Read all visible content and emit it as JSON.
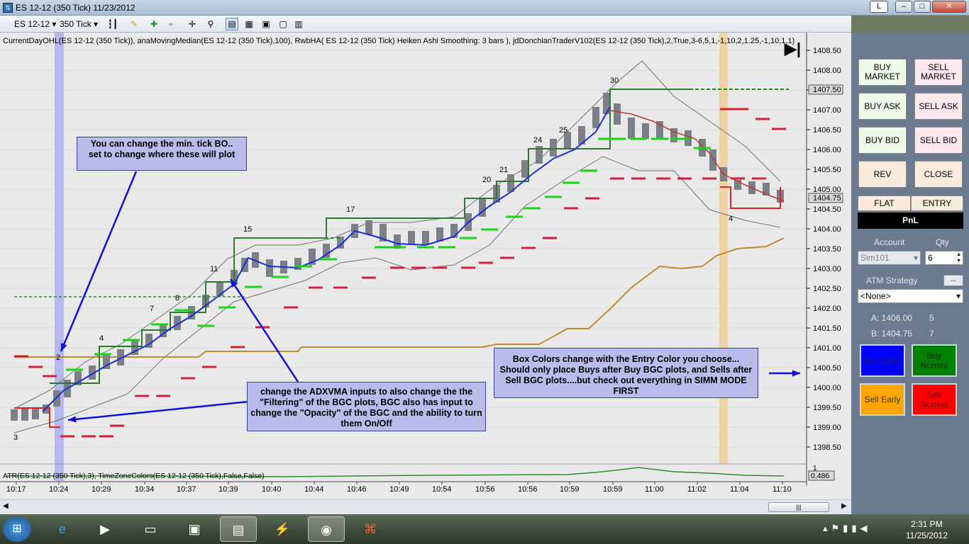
{
  "window": {
    "title": "ES 12-12 (350 Tick)  11/23/2012",
    "restore_badge": "L",
    "minimize": "–",
    "maximize": "□",
    "close": "✕"
  },
  "toolbar": {
    "instrument": "ES 12-12",
    "interval": "350 Tick"
  },
  "indicators": {
    "main": "CurrentDayOHL(ES 12-12 (350 Tick)), anaMovingMedian(ES 12-12 (350 Tick),100), RwbHA( ES 12-12 (350 Tick)  Heiken Ashi  Smoothing: 3 bars ), jdDonchianTraderV102(ES 12-12 (350 Tick),2,True,3-6,5,1,-1,10,2,1.25,-1,10,1,1)",
    "lower": "ATR(ES 12-12 (350 Tick),3), TimeZoneColors(ES 12-12 (350 Tick),False,False)",
    "lower_value": "0.486",
    "lower_top_tick": "1"
  },
  "price_axis": {
    "ticks": [
      "1408.50",
      "1408.00",
      "1407.50",
      "1407.00",
      "1406.50",
      "1406.00",
      "1405.50",
      "1405.00",
      "1404.50",
      "1404.00",
      "1403.50",
      "1403.00",
      "1402.50",
      "1402.00",
      "1401.50",
      "1401.00",
      "1400.50",
      "1400.00",
      "1399.50",
      "1399.00",
      "1398.50"
    ],
    "marker_upper": "1407.50",
    "marker_last": "1404.75"
  },
  "time_axis": {
    "ticks": [
      "10:17",
      "10:24",
      "10:29",
      "10:34",
      "10:37",
      "10:39",
      "10:40",
      "10:44",
      "10:46",
      "10:49",
      "10:54",
      "10:56",
      "10:56",
      "10:59",
      "10:59",
      "11:00",
      "11:02",
      "11:04",
      "11:10"
    ]
  },
  "swing_labels": [
    "3",
    "2",
    "4",
    "7",
    "8",
    "11",
    "15",
    "17",
    "20",
    "21",
    "24",
    "25",
    "30",
    "4"
  ],
  "annotations": {
    "tick_bo": "You can change the min. tick BO..\nset to change where these will plot",
    "adxvma": "change the ADXVMA inputs to also change the the \"Filtering\" of the BGC plots, BGC also has input to change the \"Opacity\" of the BGC and the ability to turn them On/Off",
    "box_colors": "Box Colors change with the Entry Color you choose...\nShould only place Buys after Buy BGC plots, and Sells after Sell BGC plots....but check out everything in SIMM MODE FIRST"
  },
  "panel": {
    "buy_market": "BUY\nMARKET",
    "sell_market": "SELL\nMARKET",
    "buy_ask": "BUY ASK",
    "sell_ask": "SELL ASK",
    "buy_bid": "BUY BID",
    "sell_bid": "SELL BID",
    "rev": "REV",
    "close": "CLOSE",
    "flat": "FLAT",
    "entry": "ENTRY",
    "pnl": "PnL",
    "account_label": "Account",
    "qty_label": "Qty",
    "account_value": "Sim101",
    "qty_value": "6",
    "atm_label": "ATM Strategy",
    "atm_more": "...",
    "atm_value": "<None>",
    "ask_label": "A: 1406.00",
    "ask_size": "5",
    "bid_label": "B: 1404.75",
    "bid_size": "7",
    "buy_early": "Buy Early",
    "buy_normal": "Buy Normal",
    "sell_early": "Sell Early",
    "sell_normal": "Sell Normal"
  },
  "colors": {
    "buy_early": "#0000ff",
    "buy_normal": "#008000",
    "sell_early": "#ffa500",
    "sell_normal": "#ff0000"
  },
  "taskbar": {
    "time": "2:31 PM",
    "date": "11/25/2012"
  }
}
